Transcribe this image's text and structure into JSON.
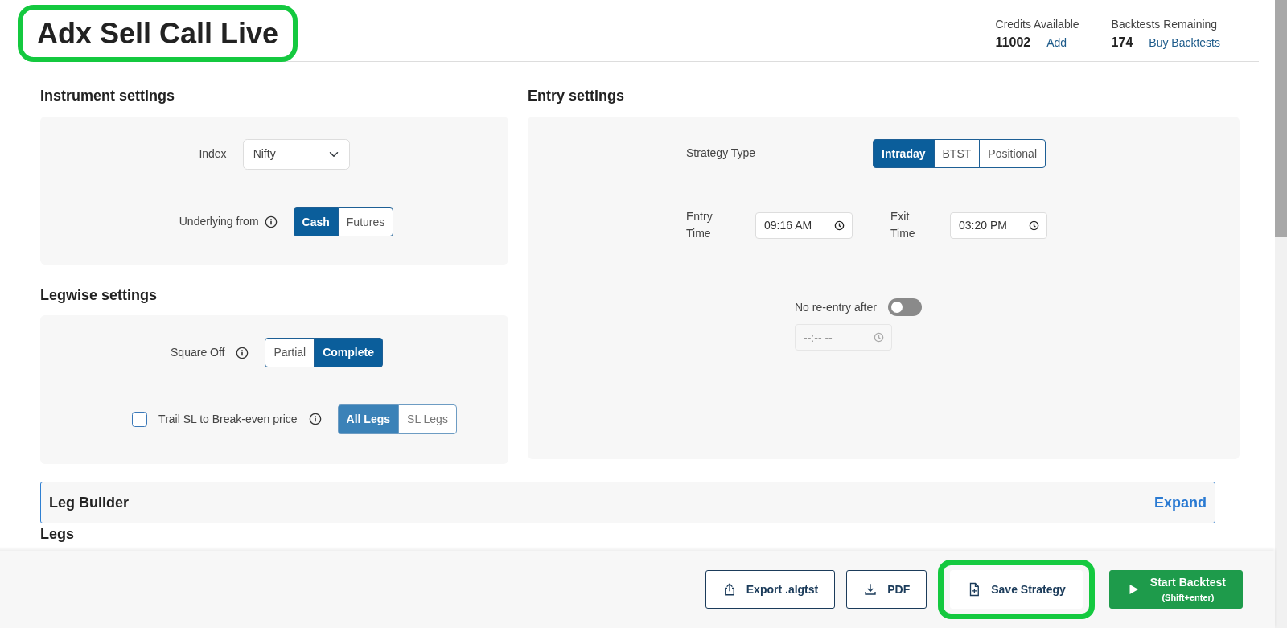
{
  "header": {
    "title": "Adx Sell Call Live",
    "title_highlighted": true,
    "stats": [
      {
        "label": "Credits Available",
        "value": "11002",
        "link": "Add"
      },
      {
        "label": "Backtests Remaining",
        "value": "174",
        "link": "Buy Backtests"
      }
    ]
  },
  "instrument_settings": {
    "heading": "Instrument settings",
    "index": {
      "label": "Index",
      "value": "Nifty"
    },
    "underlying": {
      "label": "Underlying from",
      "options": [
        {
          "label": "Cash",
          "selected": true
        },
        {
          "label": "Futures",
          "selected": false
        }
      ]
    }
  },
  "legwise_settings": {
    "heading": "Legwise settings",
    "square_off": {
      "label": "Square Off",
      "options": [
        {
          "label": "Partial",
          "selected": false
        },
        {
          "label": "Complete",
          "selected": true
        }
      ]
    },
    "trail_sl": {
      "label": "Trail SL to Break-even price",
      "checked": false,
      "options": [
        {
          "label": "All Legs",
          "selected": true
        },
        {
          "label": "SL Legs",
          "selected": false
        }
      ]
    }
  },
  "entry_settings": {
    "heading": "Entry settings",
    "strategy_type": {
      "label": "Strategy Type",
      "options": [
        {
          "label": "Intraday",
          "selected": true
        },
        {
          "label": "BTST",
          "selected": false
        },
        {
          "label": "Positional",
          "selected": false
        }
      ]
    },
    "entry_time": {
      "label": "Entry Time",
      "value": "09:16 AM"
    },
    "exit_time": {
      "label": "Exit Time",
      "value": "03:20 PM"
    },
    "no_reentry": {
      "label": "No re-entry after",
      "on": false,
      "placeholder": "--:-- --"
    }
  },
  "leg_builder": {
    "title": "Leg Builder",
    "action": "Expand"
  },
  "legs_heading": "Legs",
  "footer": {
    "buttons": [
      {
        "kind": "outline",
        "label": "Export .algtst",
        "highlighted": false
      },
      {
        "kind": "outline",
        "label": "PDF",
        "highlighted": false
      },
      {
        "kind": "outline",
        "label": "Save Strategy",
        "highlighted": true
      },
      {
        "kind": "primary",
        "label": "Start Backtest",
        "sublabel": "(Shift+enter)",
        "highlighted": false
      }
    ]
  }
}
